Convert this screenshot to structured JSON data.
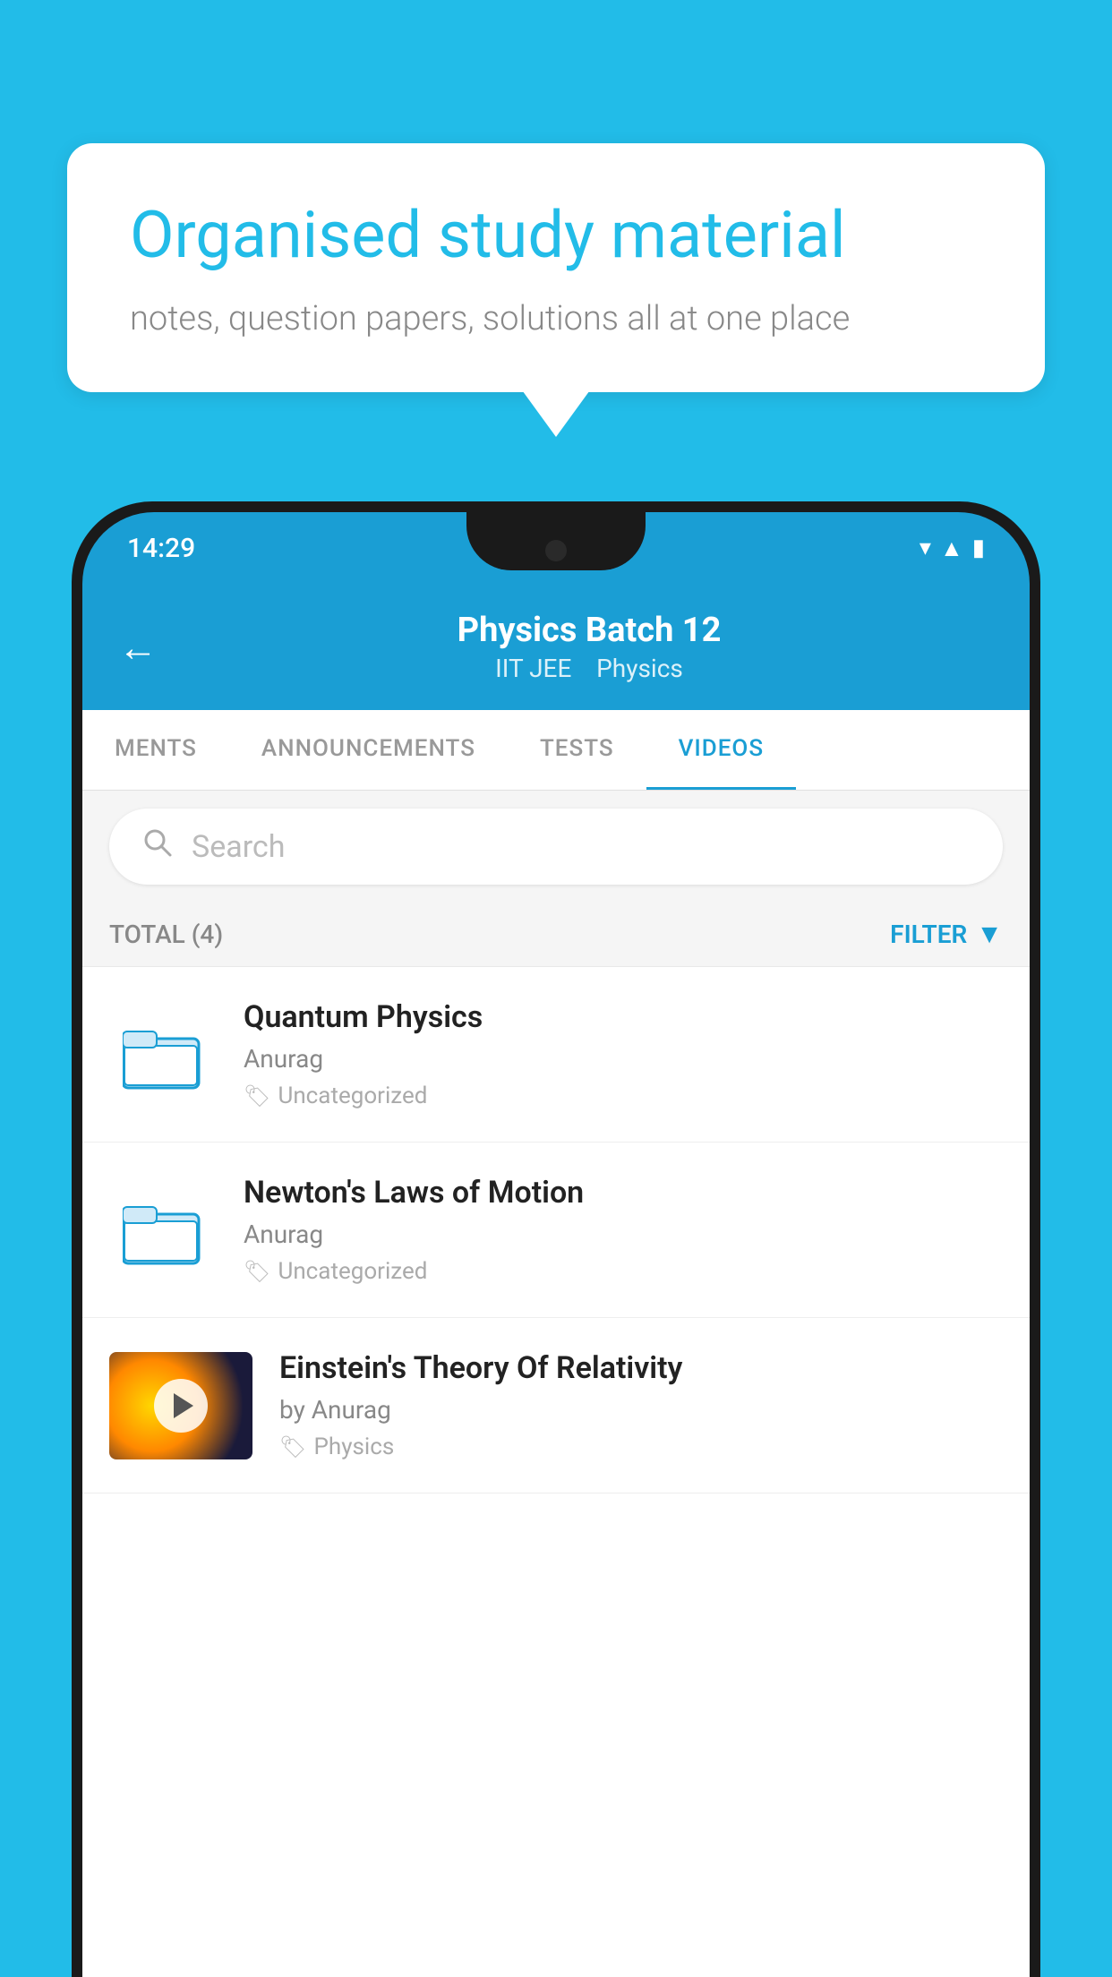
{
  "background_color": "#22bce8",
  "speech_bubble": {
    "heading": "Organised study material",
    "subtext": "notes, question papers, solutions all at one place"
  },
  "status_bar": {
    "time": "14:29",
    "icons": [
      "wifi",
      "signal",
      "battery"
    ]
  },
  "app_header": {
    "back_label": "←",
    "title": "Physics Batch 12",
    "subtitle_1": "IIT JEE",
    "subtitle_2": "Physics"
  },
  "tabs": [
    {
      "label": "MENTS",
      "active": false
    },
    {
      "label": "ANNOUNCEMENTS",
      "active": false
    },
    {
      "label": "TESTS",
      "active": false
    },
    {
      "label": "VIDEOS",
      "active": true
    }
  ],
  "search": {
    "placeholder": "Search"
  },
  "filter_bar": {
    "total_label": "TOTAL (4)",
    "filter_label": "FILTER"
  },
  "videos": [
    {
      "id": 1,
      "title": "Quantum Physics",
      "author": "Anurag",
      "tag": "Uncategorized",
      "type": "folder"
    },
    {
      "id": 2,
      "title": "Newton's Laws of Motion",
      "author": "Anurag",
      "tag": "Uncategorized",
      "type": "folder"
    },
    {
      "id": 3,
      "title": "Einstein's Theory Of Relativity",
      "author": "by Anurag",
      "tag": "Physics",
      "type": "video"
    }
  ]
}
